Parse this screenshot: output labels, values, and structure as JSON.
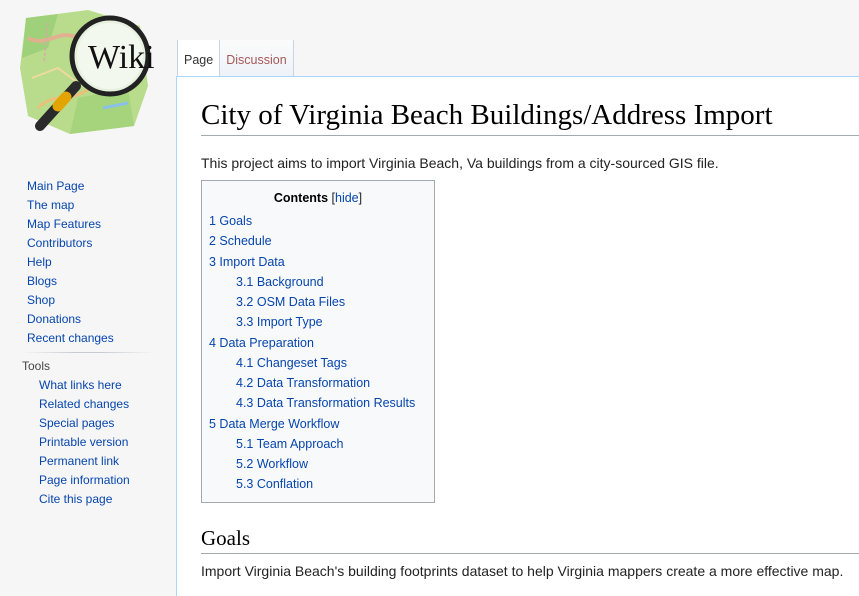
{
  "logo": {
    "text": "Wiki"
  },
  "sidebar": {
    "nav": [
      {
        "label": "Main Page"
      },
      {
        "label": "The map"
      },
      {
        "label": "Map Features"
      },
      {
        "label": "Contributors"
      },
      {
        "label": "Help"
      },
      {
        "label": "Blogs"
      },
      {
        "label": "Shop"
      },
      {
        "label": "Donations"
      },
      {
        "label": "Recent changes"
      }
    ],
    "tools_heading": "Tools",
    "tools": [
      {
        "label": "What links here"
      },
      {
        "label": "Related changes"
      },
      {
        "label": "Special pages"
      },
      {
        "label": "Printable version"
      },
      {
        "label": "Permanent link"
      },
      {
        "label": "Page information"
      },
      {
        "label": "Cite this page"
      }
    ]
  },
  "tabs": [
    {
      "label": "Page"
    },
    {
      "label": "Discussion"
    }
  ],
  "page": {
    "title": "City of Virginia Beach Buildings/Address Import",
    "intro": "This project aims to import Virginia Beach, Va buildings from a city-sourced GIS file.",
    "toc": {
      "title": "Contents",
      "toggle_open": "[",
      "toggle": "hide",
      "toggle_close": "]",
      "items": [
        {
          "text": "1 Goals"
        },
        {
          "text": "2 Schedule"
        },
        {
          "text": "3 Import Data"
        },
        {
          "text": "3.1 Background"
        },
        {
          "text": "3.2 OSM Data Files"
        },
        {
          "text": "3.3 Import Type"
        },
        {
          "text": "4 Data Preparation"
        },
        {
          "text": "4.1 Changeset Tags"
        },
        {
          "text": "4.2 Data Transformation"
        },
        {
          "text": "4.3 Data Transformation Results"
        },
        {
          "text": "5 Data Merge Workflow"
        },
        {
          "text": "5.1 Team Approach"
        },
        {
          "text": "5.2 Workflow"
        },
        {
          "text": "5.3 Conflation"
        }
      ]
    },
    "section_heading": "Goals",
    "section_text": "Import Virginia Beach's building footprints dataset to help Virginia mappers create a more effective map."
  }
}
